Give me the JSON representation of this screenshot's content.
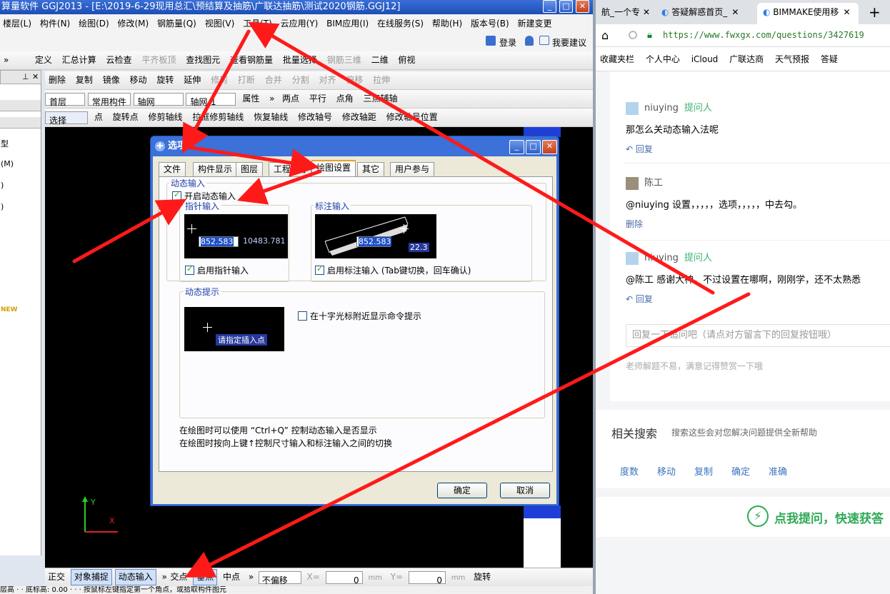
{
  "app": {
    "title": "算量软件 GGJ2013 - [E:\\2019-6-29现用总汇\\预结算及抽筋\\广联达抽筋\\测试2020钢筋.GGJ12]",
    "menu": [
      "楼层(L)",
      "构件(N)",
      "绘图(D)",
      "修改(M)",
      "钢筋量(Q)",
      "视图(V)",
      "工具(T)",
      "云应用(Y)",
      "BIM应用(I)",
      "在线服务(S)",
      "帮助(H)",
      "版本号(B)",
      "新建变更"
    ],
    "login": "登录",
    "suggest": "我要建议",
    "toolbar1": [
      "定义",
      "汇总计算",
      "云检查",
      "平齐板顶",
      "查找图元",
      "查看钢筋量",
      "批量选择",
      "钢筋三维",
      "二维",
      "俯视"
    ],
    "toolbar2": [
      "删除",
      "复制",
      "镜像",
      "移动",
      "旋转",
      "延伸",
      "修剪",
      "打断",
      "合并",
      "分割",
      "对齐",
      "偏移",
      "拉伸"
    ],
    "toolbar3": {
      "floor": "首层",
      "type": "常用构件",
      "axis": "轴网",
      "axis_id": "轴网-1",
      "props": "属性",
      "items": [
        "两点",
        "平行",
        "点角",
        "三点辅轴"
      ]
    },
    "toolbar4": [
      "选择",
      "点",
      "旋转点",
      "修剪轴线",
      "拉框修剪轴线",
      "恢复轴线",
      "修改轴号",
      "修改轴距",
      "修改轴号位置"
    ],
    "left_items": [
      "型",
      "(M)",
      ")",
      ")",
      "NEW"
    ],
    "status": {
      "ortho": "正交",
      "snap": "对象捕捉",
      "dyn": "动态输入",
      "intersect": "交点",
      "perp": "垂点",
      "mid": "中点",
      "offset": "不偏移",
      "x_label": "X=",
      "x_val": "0",
      "y_label": "Y=",
      "y_val": "0",
      "unit": "mm",
      "rotate": "旋转"
    },
    "bottom_text": "层高 · · 底标高: 0.00 · · · 按鼠标左键指定第一个角点，或拾取构件图元"
  },
  "dialog": {
    "title": "选项",
    "tabs": [
      "文件",
      "构件显示",
      "图层",
      "工程保存",
      "绘图设置",
      "其它",
      "用户参与"
    ],
    "active_tab": "绘图设置",
    "group_dynamic_input": "动态输入",
    "enable_dynamic": "开启动态输入",
    "pointer_group": "指针输入",
    "pointer_val1": "852.583",
    "pointer_val2": "10483.781",
    "enable_pointer": "启用指针输入",
    "dim_group": "标注输入",
    "dim_val1": "852.583",
    "dim_val2": "22.3",
    "enable_dim": "启用标注输入 (Tab键切换，回车确认)",
    "hint_group": "动态提示",
    "hint_preview": "请指定插入点",
    "show_hint": "在十字光标附近显示命令提示",
    "note1": "在绘图时可以使用 “Ctrl+Q” 控制动态输入是否显示",
    "note2": "在绘图时按向上键↑控制尺寸输入和标注输入之间的切换",
    "ok": "确定",
    "cancel": "取消"
  },
  "browser": {
    "tabs": [
      "航_一个专",
      "答疑解惑首页_",
      "BIMMAKE使用移"
    ],
    "url": "https://www.fwxgx.com/questions/3427619",
    "bookmarks": [
      "收藏夹栏",
      "个人中心",
      "iCloud",
      "广联达商",
      "天气预报",
      "答疑"
    ],
    "comments": [
      {
        "user": "niuying",
        "badge": "提问人",
        "text": "那怎么关动态输入法呢",
        "action": "回复"
      },
      {
        "user": "陈工",
        "badge": "",
        "text": "@niuying  设置，，，，，选项，，，，，中去勾。",
        "action": "删除"
      },
      {
        "user": "niuying",
        "badge": "提问人",
        "text": "@陈工  感谢大神，不过设置在哪啊，刚刚学，还不太熟悉",
        "action": "回复"
      }
    ],
    "reply_placeholder": "回复一下追问吧（请点对方留言下的回复按钮哦）",
    "appreciate": "老师解题不易，满意记得赞赏一下哦",
    "related_title": "相关搜索",
    "related_sub": "搜索这些会对您解决问题提供全新帮助",
    "related": [
      "度数",
      "移动",
      "复制",
      "确定",
      "准确"
    ],
    "ask_banner": "点我提问，快速获答"
  },
  "colors": {
    "arrow": "#ff1a1a",
    "brand_green": "#2daa55",
    "link_blue": "#4b6ea8"
  }
}
